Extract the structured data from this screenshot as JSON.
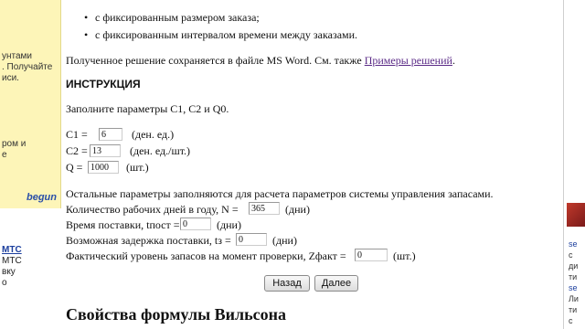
{
  "left_panel": {
    "lines": [
      "унтами",
      ". Получайте",
      "иси.",
      "ром и",
      "е"
    ],
    "begun": "begun",
    "bottom_lines": [
      "MTC",
      "МТС",
      "вку",
      "о"
    ]
  },
  "bullets": [
    "с фиксированным размером заказа;",
    "с фиксированным интервалом времени между заказами."
  ],
  "saved_text": "Полученное решение сохраняется в файле MS Word. См. также",
  "examples_link": "Примеры решений",
  "instruction_heading": "ИНСТРУКЦИЯ",
  "enter_params": "Заполните параметры C1, C2 и Q0.",
  "params": {
    "c1_label": "C1 =",
    "c1_value": "6",
    "c1_unit": "(ден. ед.)",
    "c2_label": "C2 =",
    "c2_value": "13",
    "c2_unit": "(ден. ед./шт.)",
    "q_label": "Q =",
    "q_value": "1000",
    "q_unit": "(шт.)"
  },
  "other_params_text": "Остальные параметры заполняются для расчета параметров системы управления запасами.",
  "fields": {
    "days_label": "Количество рабочих дней в году, N =",
    "days_value": "365",
    "days_unit": "(дни)",
    "delivery_label": "Время поставки, tпост =",
    "delivery_value": "0",
    "delivery_unit": "(дни)",
    "delay_label": "Возможная задержка поставки, tз =",
    "delay_value": "0",
    "delay_unit": "(дни)",
    "stock_label": "Фактический уровень запасов на момент проверки, Zфакт =",
    "stock_value": "0",
    "stock_unit": "(шт.)"
  },
  "buttons": {
    "back": "Назад",
    "next": "Далее"
  },
  "wilson_heading": "Свойства формулы Вильсона",
  "right_panel": {
    "lines": [
      "se",
      "с",
      "ди",
      "ти",
      "se",
      "Ли",
      "ти",
      "с"
    ]
  }
}
